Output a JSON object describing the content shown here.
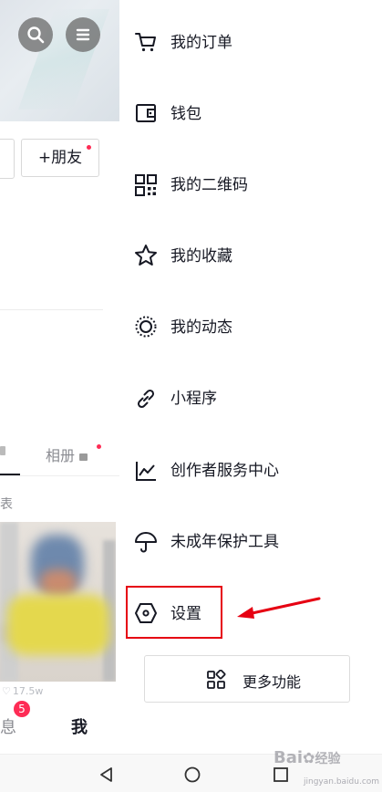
{
  "profile": {
    "friend_button_label": "+朋友",
    "tabs": {
      "album_label": "相册"
    },
    "section_text": "表",
    "video_count": "17.5w",
    "bottom_nav": {
      "messages_label": "息",
      "messages_badge": "5",
      "me_label": "我"
    }
  },
  "drawer": {
    "items": [
      {
        "label": "我的订单",
        "icon": "cart-icon"
      },
      {
        "label": "钱包",
        "icon": "wallet-icon"
      },
      {
        "label": "我的二维码",
        "icon": "qrcode-icon"
      },
      {
        "label": "我的收藏",
        "icon": "star-icon"
      },
      {
        "label": "我的动态",
        "icon": "dotted-circle-icon"
      },
      {
        "label": "小程序",
        "icon": "link-icon"
      },
      {
        "label": "创作者服务中心",
        "icon": "chart-line-icon"
      },
      {
        "label": "未成年保护工具",
        "icon": "umbrella-icon"
      },
      {
        "label": "设置",
        "icon": "hexagon-settings-icon"
      }
    ],
    "more_button_label": "更多功能"
  },
  "watermark": {
    "logo_text": "Bai",
    "logo_suffix": "经验",
    "url": "jingyan.baidu.com"
  },
  "colors": {
    "accent_red": "#fe2c55",
    "annotation_red": "#e60012",
    "text": "#161823"
  }
}
